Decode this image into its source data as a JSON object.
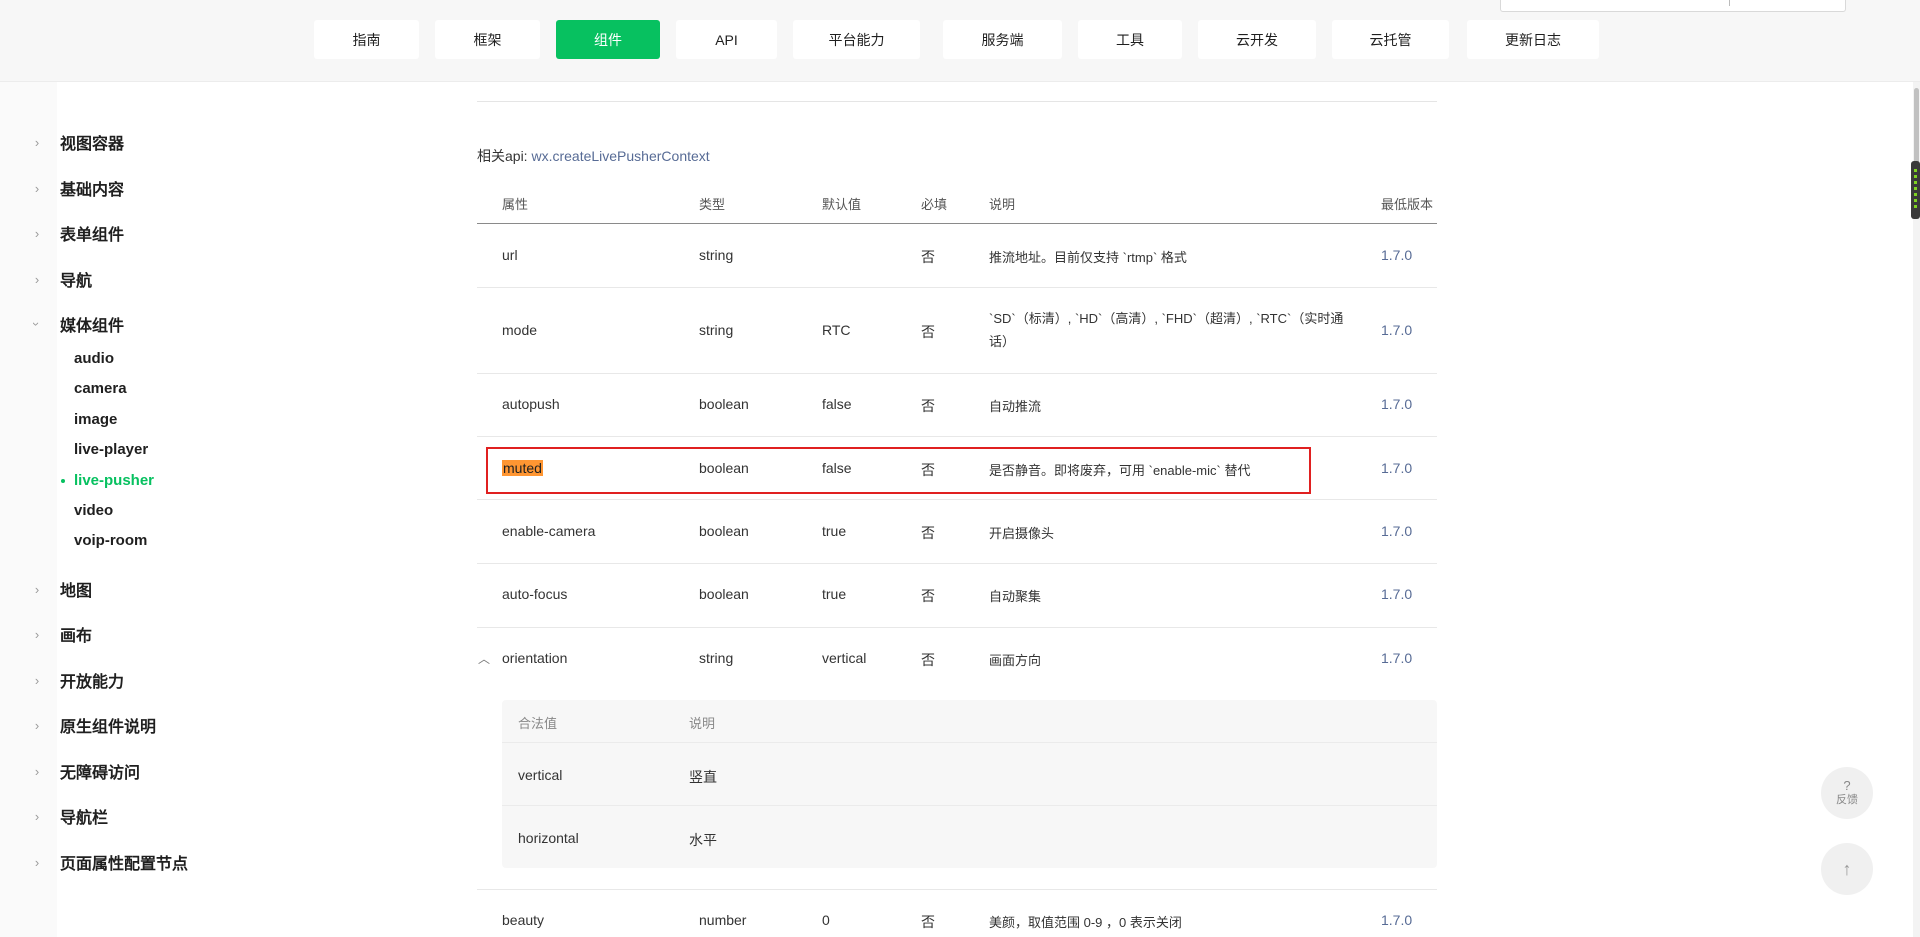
{
  "nav": {
    "items": [
      "指南",
      "框架",
      "组件",
      "API",
      "平台能力",
      "服务端",
      "工具",
      "云开发",
      "云托管",
      "更新日志"
    ],
    "active": "组件"
  },
  "sidebar": {
    "items": [
      "视图容器",
      "基础内容",
      "表单组件",
      "导航",
      "媒体组件",
      "地图",
      "画布",
      "开放能力",
      "原生组件说明",
      "无障碍访问",
      "导航栏",
      "页面属性配置节点"
    ],
    "sub_items": [
      "audio",
      "camera",
      "image",
      "live-player",
      "live-pusher",
      "video",
      "voip-room"
    ],
    "expanded": "媒体组件",
    "active_sub": "live-pusher"
  },
  "content": {
    "related_label": "相关api:",
    "related_link": "wx.createLivePusherContext",
    "headers": [
      "属性",
      "类型",
      "默认值",
      "必填",
      "说明",
      "最低版本"
    ],
    "rows": [
      {
        "attr": "url",
        "type": "string",
        "default": "",
        "required": "否",
        "desc": "推流地址。目前仅支持 `rtmp` 格式",
        "version": "1.7.0"
      },
      {
        "attr": "mode",
        "type": "string",
        "default": "RTC",
        "required": "否",
        "desc": "`SD`（标清）, `HD`（高清）, `FHD`（超清）, `RTC`（实时通话）",
        "version": "1.7.0"
      },
      {
        "attr": "autopush",
        "type": "boolean",
        "default": "false",
        "required": "否",
        "desc": "自动推流",
        "version": "1.7.0"
      },
      {
        "attr": "muted",
        "type": "boolean",
        "default": "false",
        "required": "否",
        "desc": "是否静音。即将废弃，可用 `enable-mic` 替代",
        "version": "1.7.0"
      },
      {
        "attr": "enable-camera",
        "type": "boolean",
        "default": "true",
        "required": "否",
        "desc": "开启摄像头",
        "version": "1.7.0"
      },
      {
        "attr": "auto-focus",
        "type": "boolean",
        "default": "true",
        "required": "否",
        "desc": "自动聚集",
        "version": "1.7.0"
      },
      {
        "attr": "orientation",
        "type": "string",
        "default": "vertical",
        "required": "否",
        "desc": "画面方向",
        "version": "1.7.0"
      },
      {
        "attr": "beauty",
        "type": "number",
        "default": "0",
        "required": "否",
        "desc": "美颜，取值范围 0-9 ，0 表示关闭",
        "version": "1.7.0"
      }
    ],
    "orientation_values": {
      "headers": [
        "合法值",
        "说明"
      ],
      "rows": [
        {
          "value": "vertical",
          "desc": "竖直"
        },
        {
          "value": "horizontal",
          "desc": "水平"
        }
      ]
    },
    "highlighted_attr": "muted"
  },
  "floating": {
    "feedback_icon": "?",
    "feedback_label": "反馈",
    "back_to_top_icon": "arrow-up-icon"
  },
  "colors": {
    "accent": "#07c160",
    "link": "#576b95",
    "highlight": "#ff9632",
    "outline": "#e02020"
  }
}
